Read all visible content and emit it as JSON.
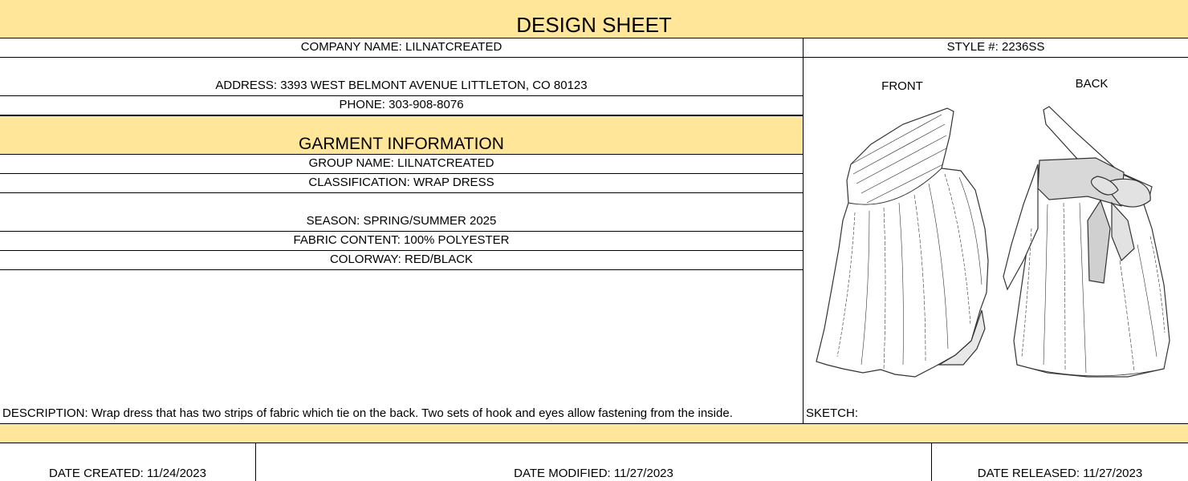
{
  "sheet": {
    "title": "DESIGN SHEET",
    "company": "COMPANY NAME: LILNATCREATED",
    "style_number": "STYLE #: 2236SS",
    "address": "ADDRESS: 3393 WEST BELMONT AVENUE LITTLETON, CO 80123",
    "phone": "PHONE: 303-908-8076"
  },
  "garment": {
    "heading": "GARMENT INFORMATION",
    "group": "GROUP NAME: LILNATCREATED",
    "classification": "CLASSIFICATION: WRAP DRESS",
    "season": "SEASON: SPRING/SUMMER 2025",
    "fabric": "FABRIC CONTENT: 100% POLYESTER",
    "colorway": "COLORWAY: RED/BLACK",
    "description": "DESCRIPTION: Wrap dress that has two strips of fabric which tie on the back. Two sets of hook and eyes allow fastening from the inside."
  },
  "sketch": {
    "label": "SKETCH:",
    "front_label": "FRONT",
    "back_label": "BACK"
  },
  "dates": {
    "created": "DATE CREATED: 11/24/2023",
    "modified": "DATE MODIFIED: 11/27/2023",
    "released": "DATE RELEASED: 11/27/2023"
  },
  "colors": {
    "band": "#ffe699",
    "lines": "#000000"
  }
}
